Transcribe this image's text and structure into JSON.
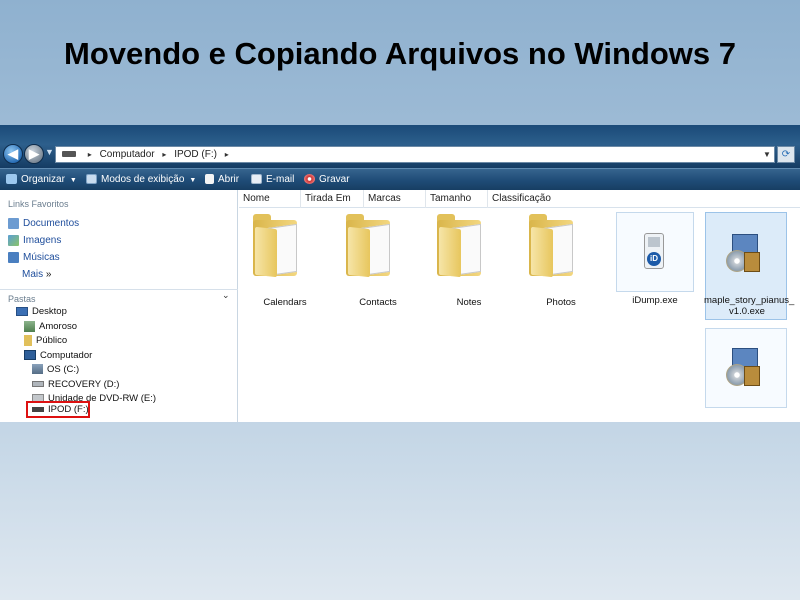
{
  "slide": {
    "title": "Movendo e Copiando Arquivos no Windows 7"
  },
  "address_bar": {
    "path": [
      "Computador",
      "IPOD (F:)"
    ],
    "sep": "▸"
  },
  "command_bar": {
    "items": [
      {
        "label": "Organizar",
        "dropdown": true
      },
      {
        "label": "Modos de exibição",
        "dropdown": true
      },
      {
        "label": "Abrir"
      },
      {
        "label": "E-mail"
      },
      {
        "label": "Gravar"
      }
    ]
  },
  "nav_pane": {
    "favorites_title": "Links Favoritos",
    "favorites": [
      "Documentos",
      "Imagens",
      "Músicas"
    ],
    "more_label": "Mais",
    "more_glyph": "»",
    "folders_title": "Pastas",
    "tree": [
      {
        "label": "Desktop"
      },
      {
        "label": "Amoroso"
      },
      {
        "label": "Público"
      },
      {
        "label": "Computador"
      },
      {
        "label": "OS (C:)"
      },
      {
        "label": "RECOVERY (D:)"
      },
      {
        "label": "Unidade de DVD-RW (E:)"
      },
      {
        "label": "IPOD (F:)",
        "highlighted": true
      }
    ]
  },
  "columns": [
    "Nome",
    "Tirada Em",
    "Marcas",
    "Tamanho",
    "Classificação"
  ],
  "files": [
    {
      "name": "Calendars",
      "kind": "folder"
    },
    {
      "name": "Contacts",
      "kind": "folder"
    },
    {
      "name": "Notes",
      "kind": "folder"
    },
    {
      "name": "Photos",
      "kind": "folder"
    },
    {
      "name": "iDump.exe",
      "kind": "exe"
    },
    {
      "name_line1": "maple_story_pianus_",
      "name_line2": "v1.0.exe",
      "kind": "installer",
      "selected": true
    },
    {
      "name": "",
      "kind": "installer"
    }
  ],
  "colors": {
    "slide_bg_top": "#8fb1cf",
    "address_bar": "#1f4c77",
    "link_text": "#1f4e9c",
    "highlight_box": "#dd1111",
    "selection": "#dcebf9"
  }
}
